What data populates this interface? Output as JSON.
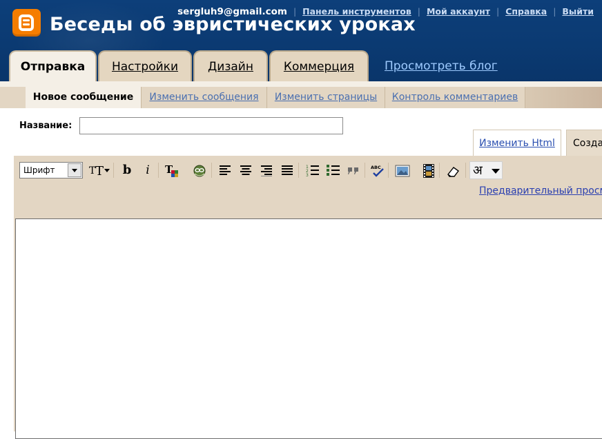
{
  "header": {
    "blog_title": "Беседы об эвристических уроках",
    "email": "sergluh9@gmail.com",
    "links": {
      "dashboard": "Панель инструментов",
      "account": "Мой аккаунт",
      "help": "Справка",
      "logout": "Выйти"
    },
    "logo_icon": "blogger-logo-icon",
    "accent": "#f57d00",
    "bg": "#0b3a72"
  },
  "main_tabs": [
    {
      "label": "Отправка",
      "active": true
    },
    {
      "label": "Настройки",
      "active": false
    },
    {
      "label": "Дизайн",
      "active": false
    },
    {
      "label": "Коммерция",
      "active": false
    }
  ],
  "view_blog": "Просмотреть блог",
  "sub_tabs": [
    {
      "label": "Новое сообщение",
      "active": true
    },
    {
      "label": "Изменить сообщения",
      "active": false
    },
    {
      "label": "Изменить страницы",
      "active": false
    },
    {
      "label": "Контроль комментариев",
      "active": false
    }
  ],
  "form": {
    "title_label": "Название:",
    "title_value": "",
    "mode_tabs": {
      "html": "Изменить Html",
      "compose": "Созда"
    }
  },
  "toolbar": {
    "font_select": "Шрифт",
    "buttons": [
      "font-size-icon",
      "bold-icon",
      "italic-icon",
      "text-color-icon",
      "link-icon",
      "align-left-icon",
      "align-center-icon",
      "align-right-icon",
      "align-justify-icon",
      "numbered-list-icon",
      "bullet-list-icon",
      "blockquote-icon",
      "spellcheck-icon",
      "insert-image-icon",
      "insert-video-icon",
      "remove-formatting-icon",
      "transliteration-icon"
    ],
    "bold_glyph": "b",
    "italic_glyph": "i",
    "translit_glyph": "अ",
    "preview_link": "Предварительный просмо"
  },
  "editor": {
    "content": ""
  }
}
